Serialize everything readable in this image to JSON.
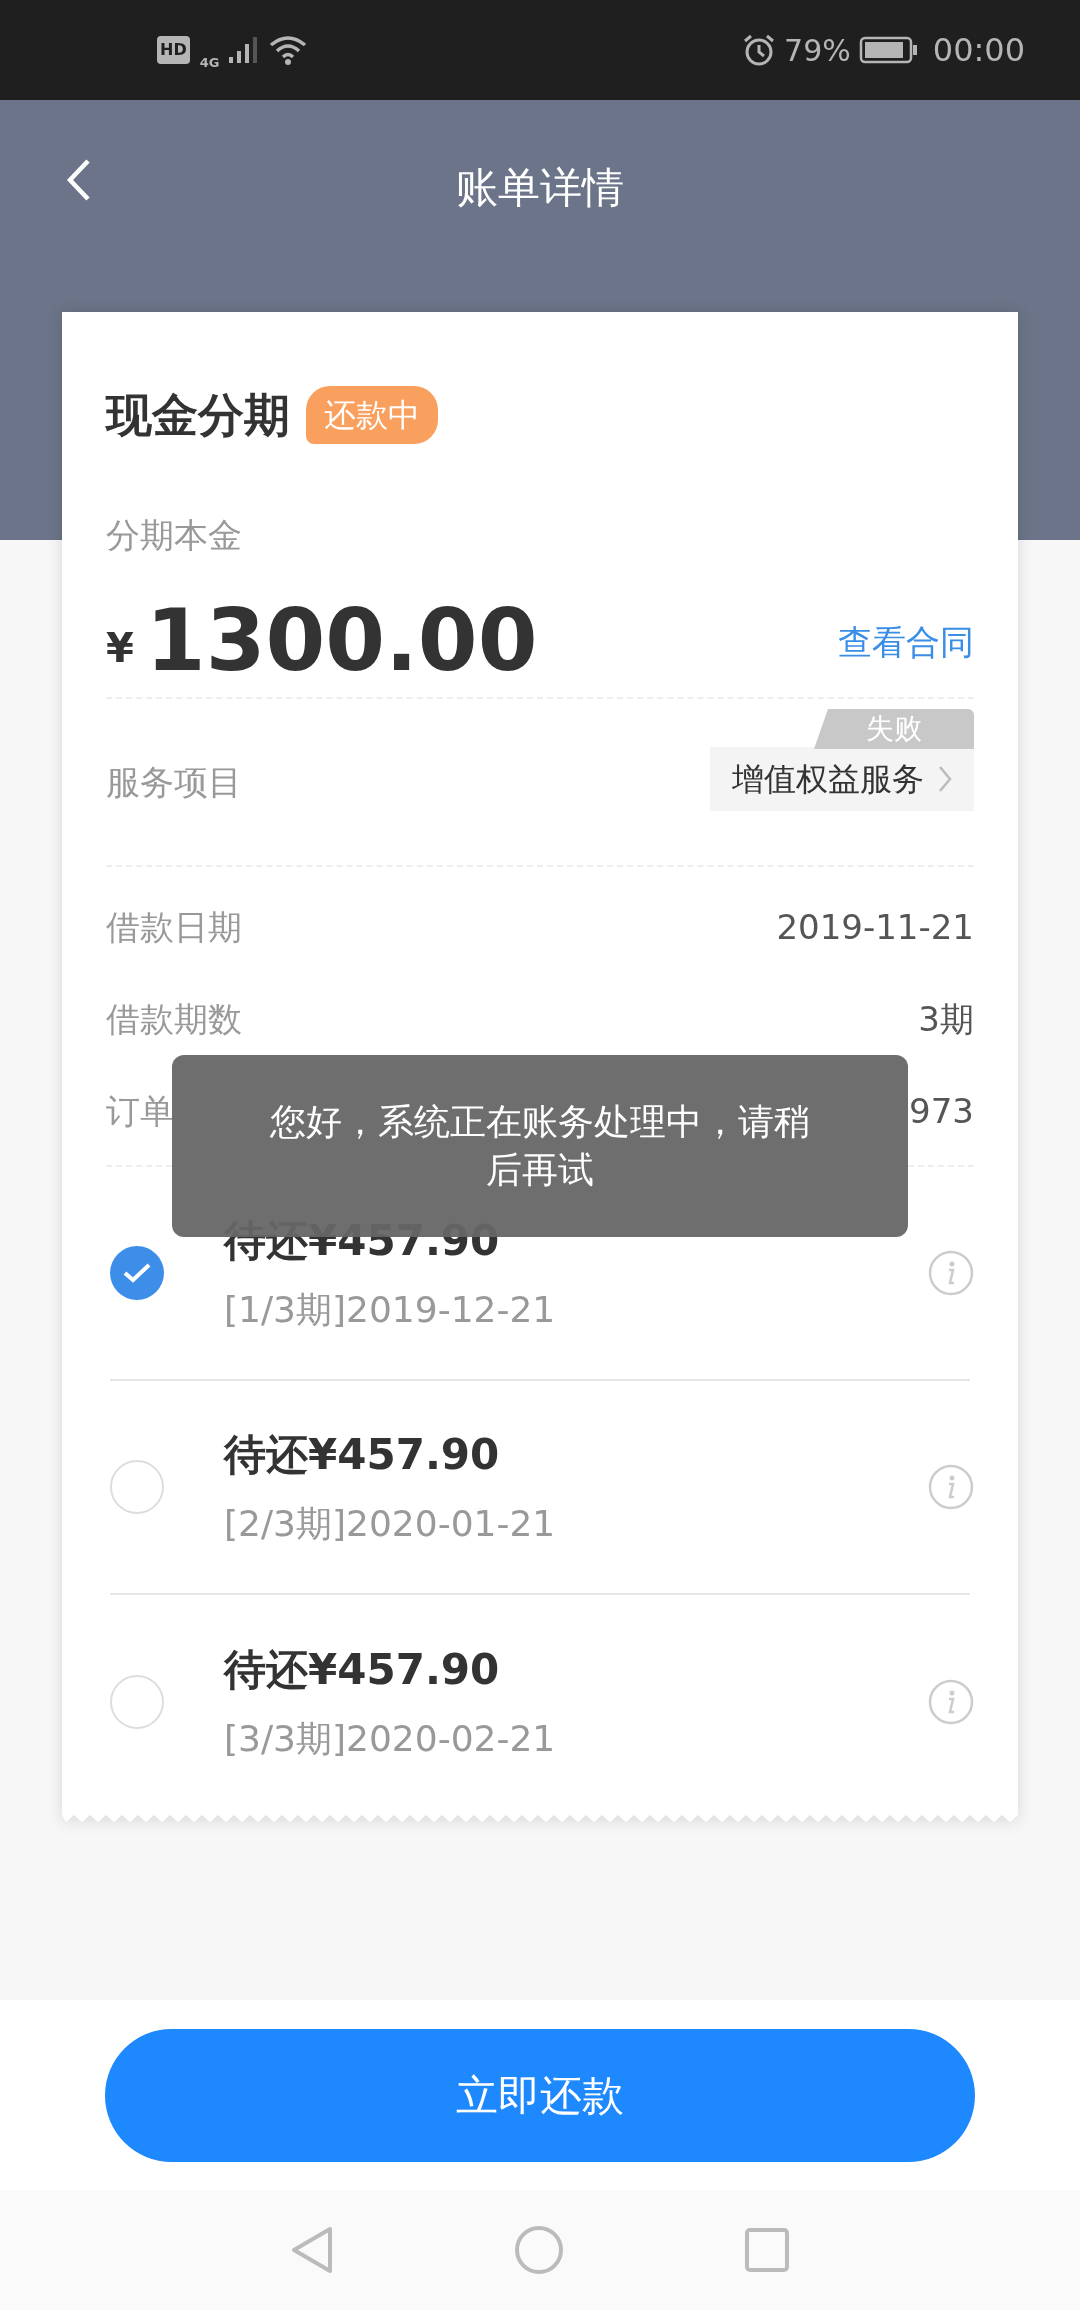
{
  "status_bar": {
    "hd": "HD",
    "network": "4G",
    "battery": "79%",
    "time": "00:00"
  },
  "header": {
    "title": "账单详情"
  },
  "loan": {
    "title": "现金分期",
    "badge": "还款中",
    "principal_label": "分期本金",
    "currency": "¥",
    "amount": "1300.00",
    "contract_link": "查看合同",
    "service": {
      "label": "服务项目",
      "value": "增值权益服务",
      "tag": "失败"
    },
    "details": [
      {
        "label": "借款日期",
        "value": "2019-11-21"
      },
      {
        "label": "借款期数",
        "value": "3期"
      },
      {
        "label": "订单",
        "value": "973"
      }
    ]
  },
  "installments": [
    {
      "amount": "待还¥457.90",
      "period": "[1/3期]2019-12-21",
      "selected": true
    },
    {
      "amount": "待还¥457.90",
      "period": "[2/3期]2020-01-21",
      "selected": false
    },
    {
      "amount": "待还¥457.90",
      "period": "[3/3期]2020-02-21",
      "selected": false
    }
  ],
  "toast": "您好，系统正在账务处理中，请稍后再试",
  "pay_button": "立即还款"
}
